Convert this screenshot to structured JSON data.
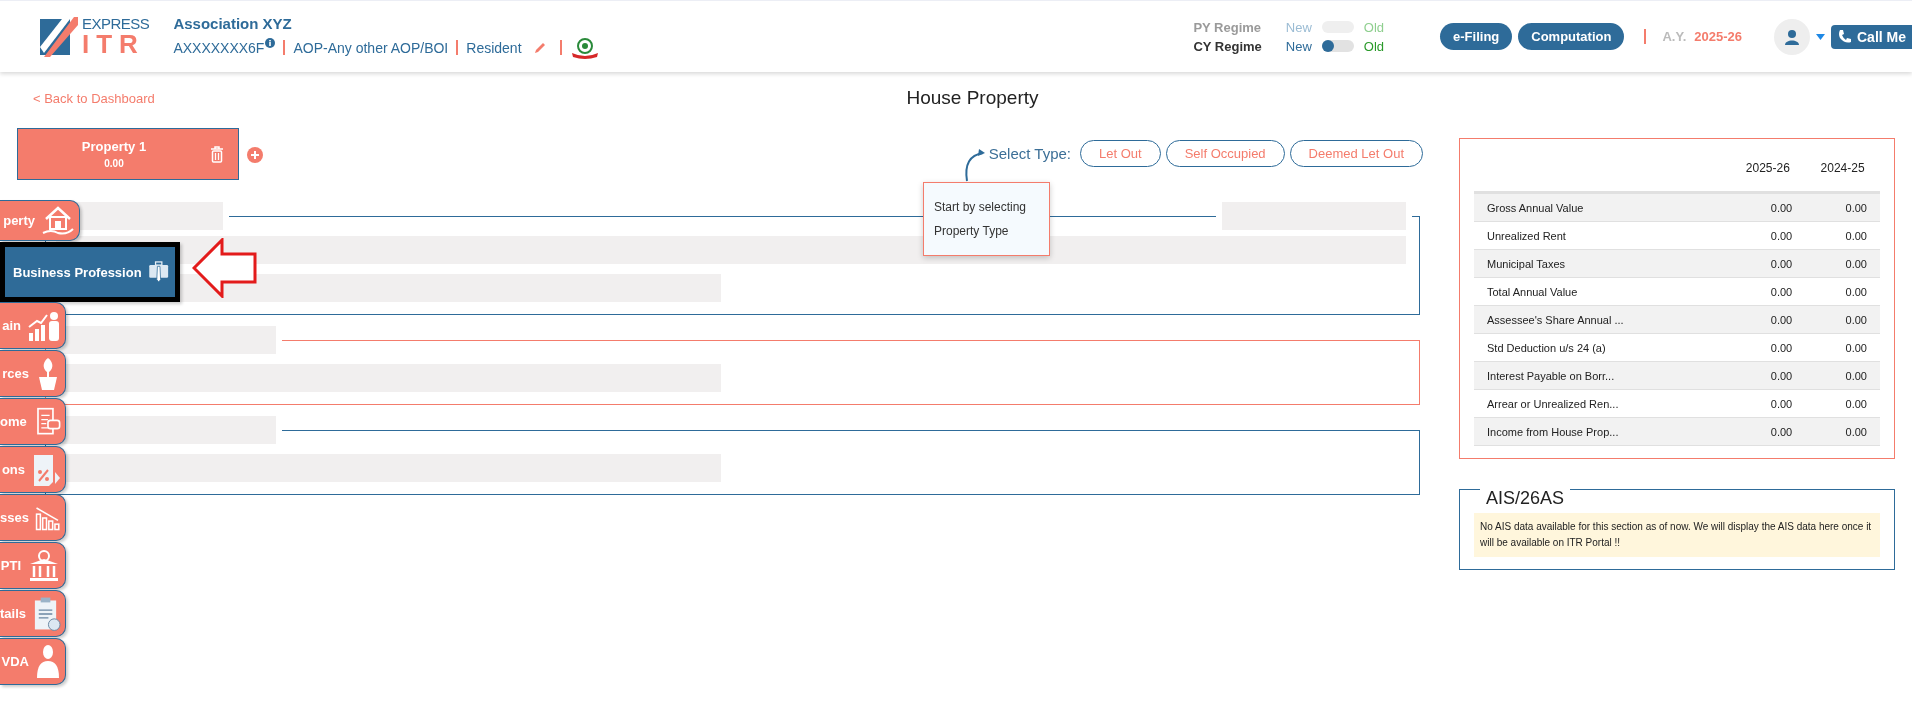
{
  "header": {
    "logo": {
      "top": "EXPRESS",
      "bottom": "ITR"
    },
    "entity_name": "Association XYZ",
    "pan": "AXXXXXXX6F",
    "entity_type": "AOP-Any other AOP/BOI",
    "residency": "Resident",
    "regimes": [
      {
        "label": "PY Regime",
        "new": "New",
        "old": "Old",
        "disabled": true
      },
      {
        "label": "CY Regime",
        "new": "New",
        "old": "Old",
        "on": false,
        "disabled": false
      }
    ],
    "buttons": [
      "e-Filing",
      "Computation"
    ],
    "ay_label": "A.Y.",
    "ay_value": "2025-26",
    "call_button": "Call Me"
  },
  "back_link": "< Back to Dashboard",
  "page_title": "House Property",
  "properties": [
    {
      "name": "Property 1",
      "amount": "0.00",
      "selected": true
    }
  ],
  "select_type": {
    "label": "Select Type:",
    "options": [
      {
        "label": "Let Out",
        "selected": false
      },
      {
        "label": "Self Occupied",
        "selected": false
      },
      {
        "label": "Deemed Let Out",
        "selected": false
      }
    ]
  },
  "tooltip": "Start by selecting Property Type",
  "sections": [
    {
      "kind": "full",
      "color": "#2e6b99"
    },
    {
      "kind": "compact",
      "color": "#f47c6c"
    },
    {
      "kind": "compact",
      "color": "#2e6b99"
    }
  ],
  "sidebar": [
    {
      "label": "perty",
      "selected": false
    },
    {
      "label": "Business Profession",
      "selected": true
    },
    {
      "label": "ain",
      "selected": false
    },
    {
      "label": "rces",
      "selected": false
    },
    {
      "label": "ome",
      "selected": false
    },
    {
      "label": "ons",
      "selected": false
    },
    {
      "label": "sses",
      "selected": false
    },
    {
      "label": "PTI",
      "selected": false
    },
    {
      "label": "tails",
      "selected": false
    },
    {
      "label": "VDA",
      "selected": false
    }
  ],
  "summary": {
    "columns": [
      "2025-26",
      "2024-25"
    ],
    "rows": [
      {
        "label": "Gross Annual Value",
        "values": [
          "0.00",
          "0.00"
        ]
      },
      {
        "label": "Unrealized Rent",
        "values": [
          "0.00",
          "0.00"
        ]
      },
      {
        "label": "Municipal Taxes",
        "values": [
          "0.00",
          "0.00"
        ]
      },
      {
        "label": "Total Annual Value",
        "values": [
          "0.00",
          "0.00"
        ]
      },
      {
        "label": "Assessee's Share Annual ...",
        "values": [
          "0.00",
          "0.00"
        ]
      },
      {
        "label": "Std Deduction u/s 24 (a)",
        "values": [
          "0.00",
          "0.00"
        ]
      },
      {
        "label": "Interest Payable on Borr...",
        "values": [
          "0.00",
          "0.00"
        ]
      },
      {
        "label": "Arrear or Unrealized Ren...",
        "values": [
          "0.00",
          "0.00"
        ]
      },
      {
        "label": "Income from House Prop...",
        "values": [
          "0.00",
          "0.00"
        ]
      }
    ]
  },
  "ais": {
    "title": "AIS/26AS",
    "message": "No AIS data available for this section as of now. We will display the AIS data here once it will be available on ITR Portal !!"
  }
}
